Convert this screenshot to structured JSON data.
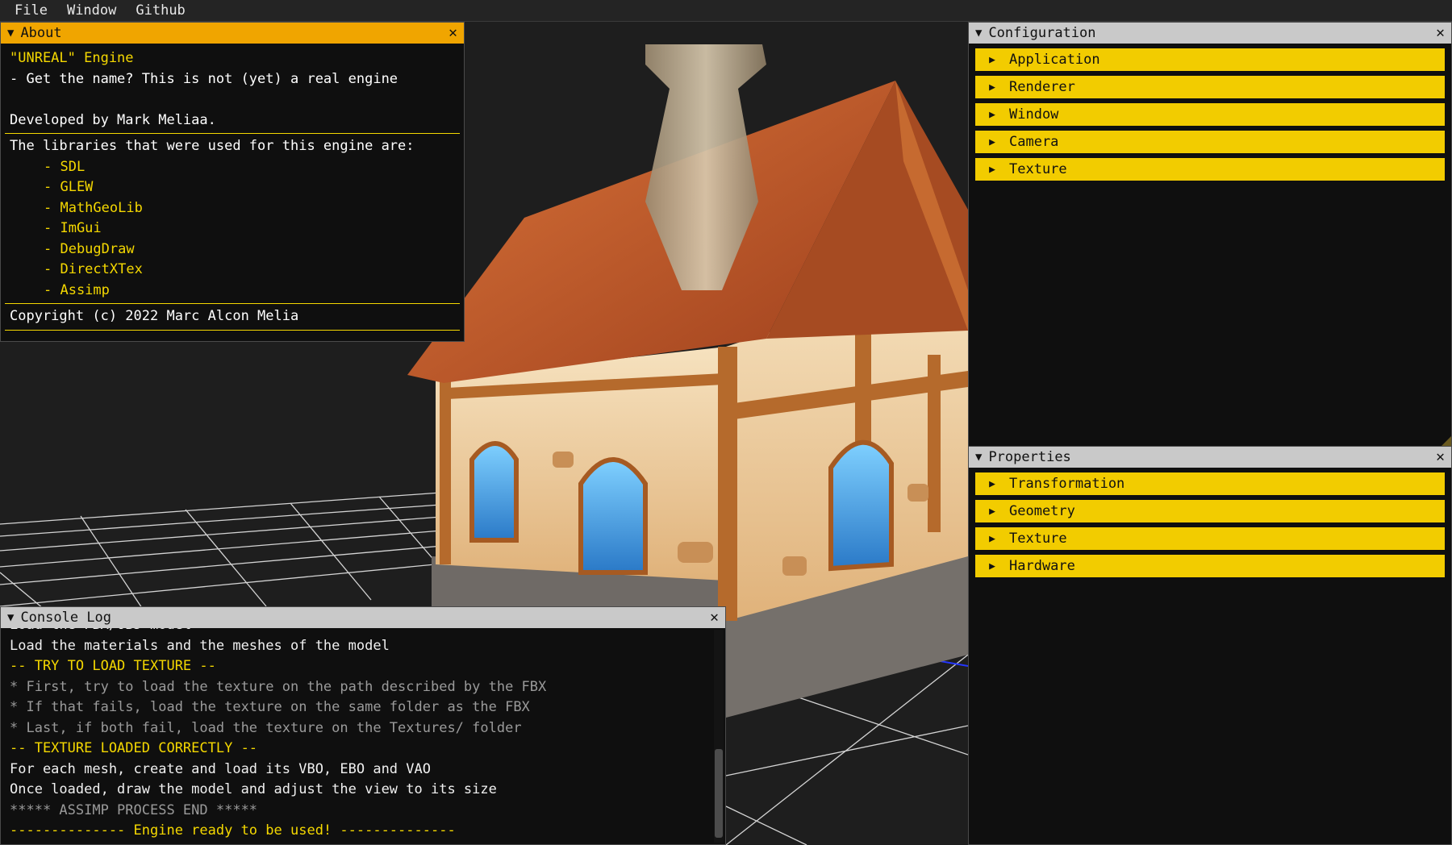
{
  "menu": [
    "File",
    "Window",
    "Github"
  ],
  "about": {
    "title": "About",
    "lines": [
      "\"UNREAL\" Engine",
      "- Get the name? This is not (yet) a real engine",
      "",
      "Developed by Mark Meliaa."
    ],
    "libraries_header": "The libraries that were used for this engine are:",
    "libraries": [
      "- SDL",
      "- GLEW",
      "- MathGeoLib",
      "- ImGui",
      "- DebugDraw",
      "- DirectXTex",
      "- Assimp"
    ],
    "copyright": "Copyright (c) 2022 Marc Alcon Melia"
  },
  "configuration": {
    "title": "Configuration",
    "sections": [
      "Application",
      "Renderer",
      "Window",
      "Camera",
      "Texture"
    ]
  },
  "properties": {
    "title": "Properties",
    "sections": [
      "Transformation",
      "Geometry",
      "Texture",
      "Hardware"
    ]
  },
  "console": {
    "title": "Console Log",
    "lines": [
      {
        "text": "Load the FBX/OBJ model",
        "style": "w"
      },
      {
        "text": "Load the materials and the meshes of the model",
        "style": "w"
      },
      {
        "text": "-- TRY TO LOAD TEXTURE --",
        "style": "y"
      },
      {
        "text": "* First, try to load the texture on the path described by the FBX",
        "style": "g"
      },
      {
        "text": "* If that fails, load the texture on the same folder as the FBX",
        "style": "g"
      },
      {
        "text": "* Last, if both fail, load the texture on the Textures/ folder",
        "style": "g"
      },
      {
        "text": "-- TEXTURE LOADED CORRECTLY --",
        "style": "y"
      },
      {
        "text": "For each mesh, create and load its VBO, EBO and VAO",
        "style": "w"
      },
      {
        "text": "Once loaded, draw the model and adjust the view to its size",
        "style": "w"
      },
      {
        "text": "***** ASSIMP PROCESS END *****",
        "style": "g"
      },
      {
        "text": "-------------- Engine ready to be used! --------------",
        "style": "y"
      }
    ]
  },
  "icons": {
    "collapse": "triangle-down-icon",
    "expand": "triangle-right-icon",
    "close": "close-icon"
  },
  "colors": {
    "accent": "#f2cc00",
    "active_title": "#f0a500",
    "inactive_title": "#c9c9c9",
    "panel_bg": "#0f0f0f"
  }
}
